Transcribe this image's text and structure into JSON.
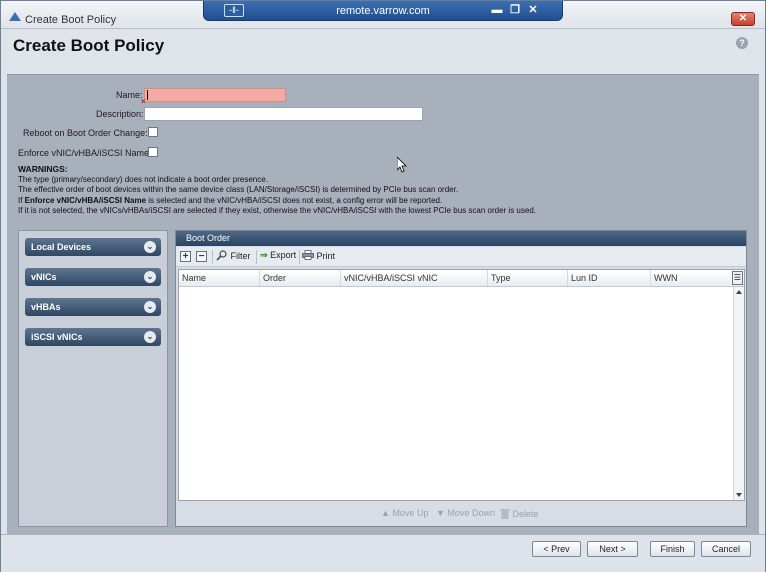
{
  "remote": {
    "pin": "-‖-",
    "title": "remote.varrow.com",
    "minimize": "▬",
    "restore": "❐",
    "close": "✕"
  },
  "window": {
    "title": "Create Boot Policy",
    "close_glyph": "✕",
    "help_glyph": "?"
  },
  "page": {
    "title": "Create Boot Policy"
  },
  "form": {
    "name_label": "Name:",
    "name_value": "",
    "description_label": "Description:",
    "description_value": "",
    "reboot_label": "Reboot on Boot Order Change:",
    "reboot_checked": false,
    "enforce_label": "Enforce vNIC/vHBA/iSCSI Name:",
    "enforce_checked": false
  },
  "warnings": {
    "title": "WARNINGS:",
    "line1": "The type (primary/secondary) does not indicate a boot order presence.",
    "line2": "The effective order of boot devices within the same device class (LAN/Storage/iSCSI) is determined by PCIe bus scan order.",
    "line3_prefix": "If ",
    "line3_bold": "Enforce vNIC/vHBA/iSCSI Name",
    "line3_suffix": " is selected and the vNIC/vHBA/iSCSI does not exist, a config error will be reported.",
    "line4": "If it is not selected, the vNICs/vHBAs/iSCSI are selected if they exist, otherwise the vNIC/vHBA/iSCSI with the lowest PCIe bus scan order is used."
  },
  "accordion": [
    {
      "label": "Local Devices",
      "icon": "chevron-double-down-icon",
      "glyph": "⌄"
    },
    {
      "label": "vNICs",
      "icon": "chevron-double-down-icon",
      "glyph": "⌄"
    },
    {
      "label": "vHBAs",
      "icon": "chevron-double-down-icon",
      "glyph": "⌄"
    },
    {
      "label": "iSCSI vNICs",
      "icon": "chevron-double-down-icon",
      "glyph": "⌄"
    }
  ],
  "boot_order": {
    "title": "Boot Order",
    "toolbar": {
      "add_glyph": "+",
      "remove_glyph": "−",
      "filter": "Filter",
      "export": "Export",
      "print": "Print"
    },
    "columns": [
      "Name",
      "Order",
      "vNIC/vHBA/iSCSI vNIC",
      "Type",
      "Lun ID",
      "WWN"
    ],
    "column_chooser_glyph": "☰",
    "rows": [],
    "actions": {
      "move_up": "Move Up",
      "move_down": "Move Down",
      "delete": "Delete"
    }
  },
  "footer": {
    "prev": "< Prev",
    "next": "Next >",
    "finish": "Finish",
    "cancel": "Cancel"
  }
}
